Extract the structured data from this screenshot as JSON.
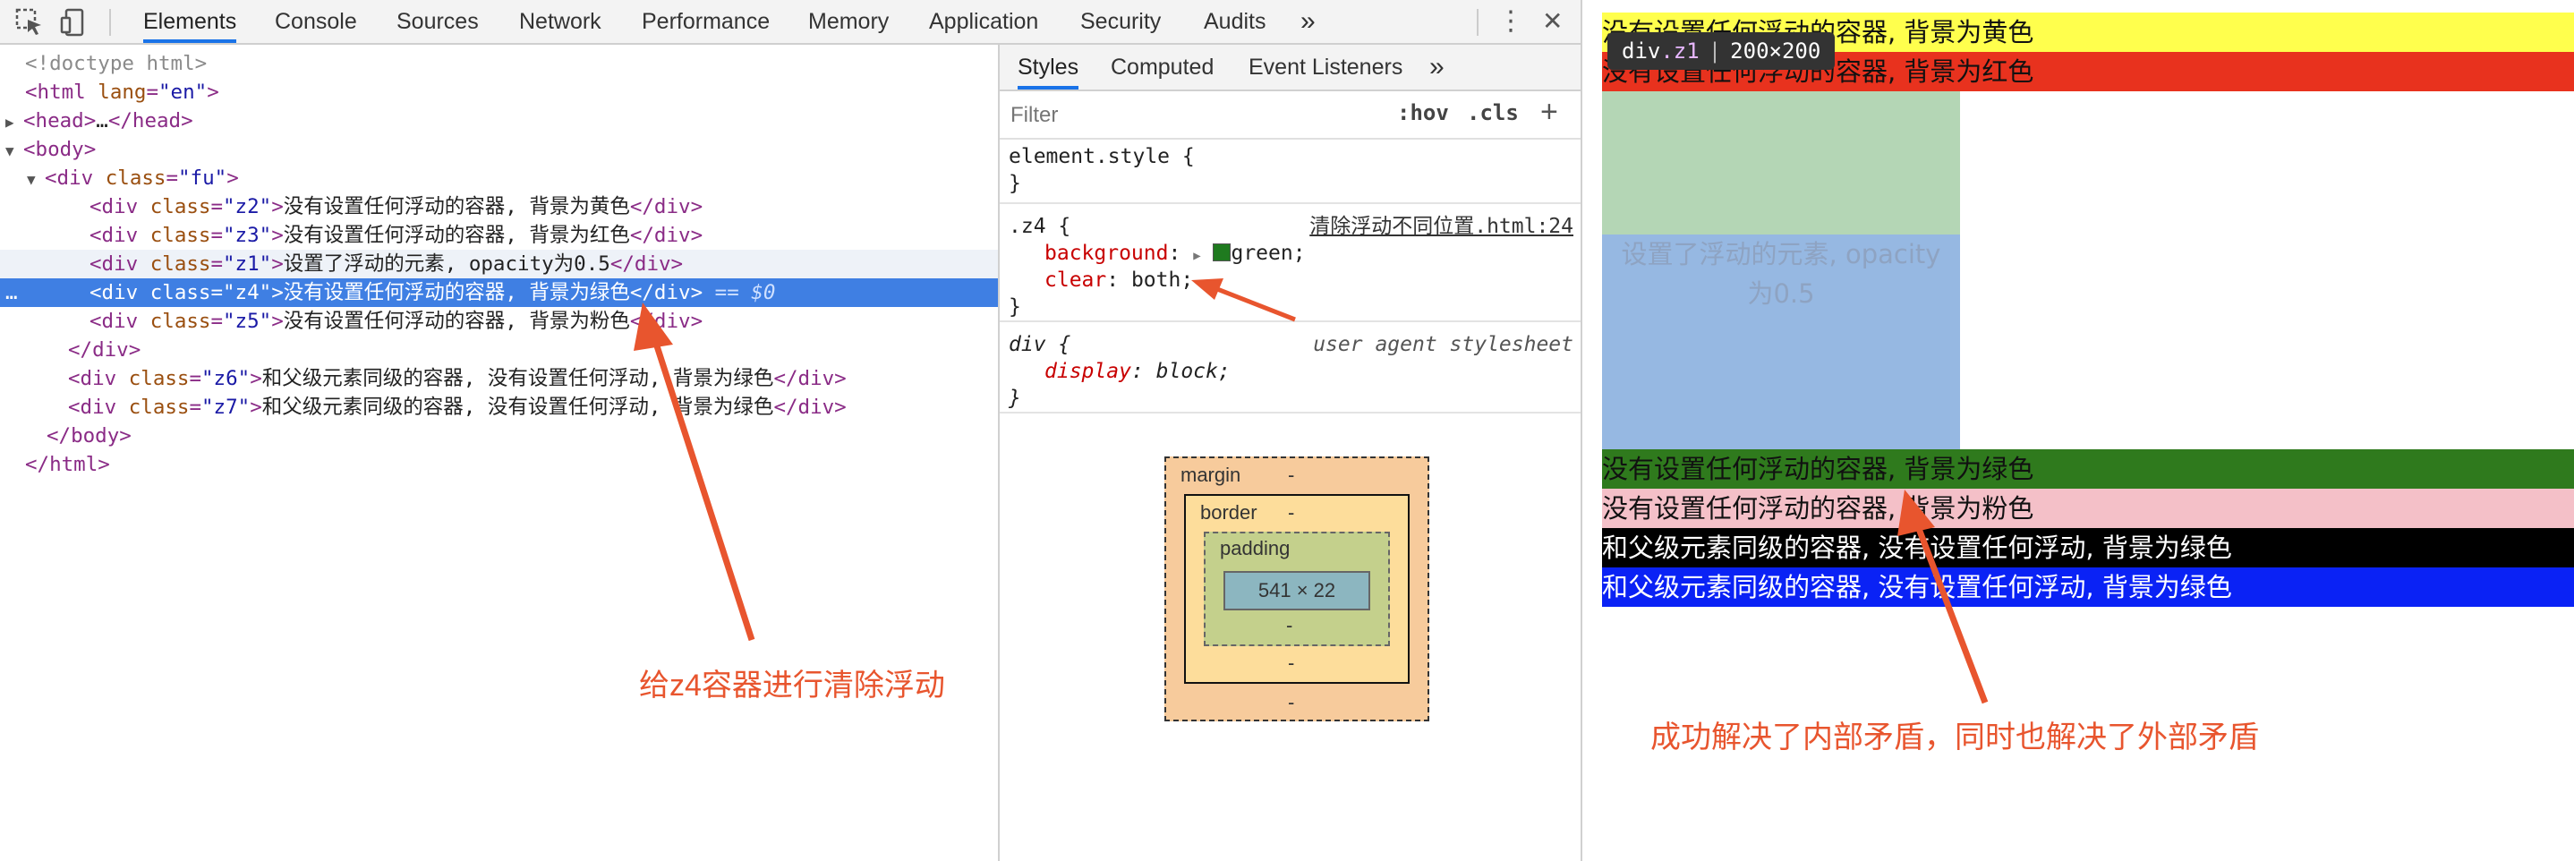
{
  "toolbar": {
    "tabs": [
      "Elements",
      "Console",
      "Sources",
      "Network",
      "Performance",
      "Memory",
      "Application",
      "Security",
      "Audits"
    ],
    "more": "»",
    "menu": "⋮",
    "close": "✕"
  },
  "elements": {
    "lines": [
      [
        "<!doctype html>"
      ],
      [
        "<html lang=\"en\">"
      ],
      [
        "<head>…</head>"
      ],
      [
        "<body>"
      ],
      [
        "<div class=\"fu\">"
      ],
      [
        "<div class=\"z2\">没有设置任何浮动的容器, 背景为黄色</div>"
      ],
      [
        "<div class=\"z3\">没有设置任何浮动的容器, 背景为红色</div>"
      ],
      [
        "<div class=\"z1\">设置了浮动的元素, opacity为0.5</div>"
      ],
      [
        "<div class=\"z4\">没有设置任何浮动的容器, 背景为绿色</div>"
      ],
      [
        "<div class=\"z5\">没有设置任何浮动的容器, 背景为粉色</div>"
      ],
      [
        "</div>"
      ],
      [
        "<div class=\"z6\">和父级元素同级的容器, 没有设置任何浮动, 背景为绿色</div>"
      ],
      [
        "<div class=\"z7\">和父级元素同级的容器, 没有设置任何浮动, 背景为绿色</div>"
      ],
      [
        "</body>"
      ],
      [
        "</html>"
      ]
    ],
    "selected_suffix": "== $0",
    "dots": "…"
  },
  "styles": {
    "tabs": [
      "Styles",
      "Computed",
      "Event Listeners"
    ],
    "more": "»",
    "filter_placeholder": "Filter",
    "hov": ":hov",
    "cls": ".cls",
    "plus": "+",
    "element_style": "element.style {",
    "close_brace": "}",
    "z4_selector": ".z4 {",
    "z4_source": "清除浮动不同位置.html:24",
    "z4_bg_prop": "background",
    "z4_bg_val": "green;",
    "z4_clear_prop": "clear",
    "z4_clear_val": "both;",
    "div_selector": "div {",
    "div_source": "user agent stylesheet",
    "div_display_prop": "display",
    "div_display_val": "block;"
  },
  "box_model": {
    "margin_label": "margin",
    "border_label": "border",
    "padding_label": "padding",
    "content": "541 × 22",
    "dash": "-"
  },
  "page": {
    "z2": "没有设置任何浮动的容器, 背景为黄色",
    "z3": "没有设置任何浮动的容器, 背景为红色",
    "z1": "设置了浮动的元素, opacity为0.5",
    "z4": "没有设置任何浮动的容器, 背景为绿色",
    "z5": "没有设置任何浮动的容器, 背景为粉色",
    "z6": "和父级元素同级的容器, 没有设置任何浮动, 背景为绿色",
    "z7": "和父级元素同级的容器, 没有设置任何浮动, 背景为绿色",
    "tooltip_tag": "div",
    "tooltip_class": ".z1",
    "tooltip_size": "200×200",
    "colors": {
      "yellow": "#ffff4d",
      "red": "#e8321e",
      "green": "#2f7a1d",
      "pink": "#f4c0c8",
      "black": "#000000",
      "blue": "#0a22f5",
      "float_blue": "#96b8e2",
      "float_green_overlap": "#b4d6b5"
    }
  },
  "annotations": {
    "left": "给z4容器进行清除浮动",
    "right": "成功解决了内部矛盾，同时也解决了外部矛盾",
    "color": "#e8552e"
  }
}
